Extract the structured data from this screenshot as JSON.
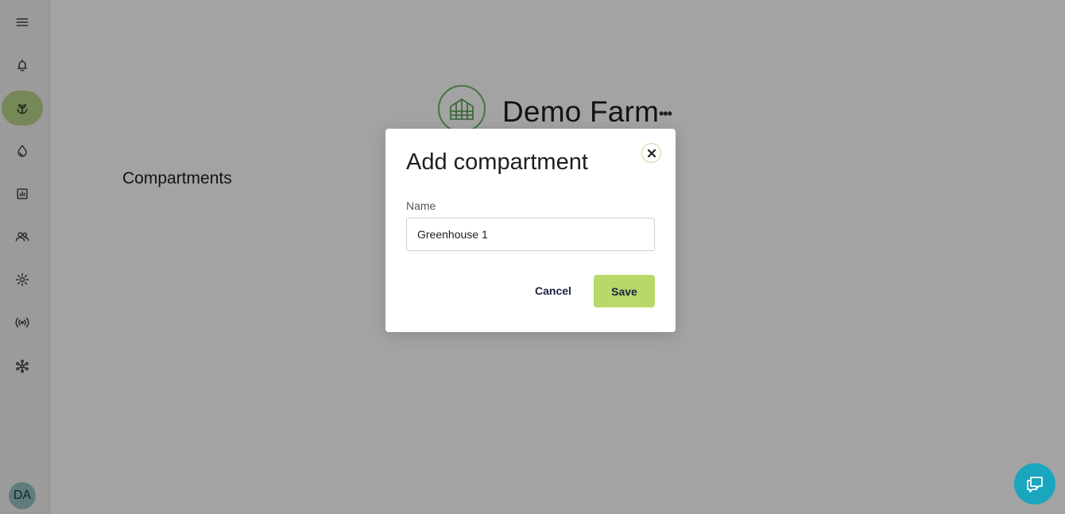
{
  "sidebar": {
    "items": [
      {
        "name": "menu",
        "icon": "menu-icon"
      },
      {
        "name": "notifications",
        "icon": "bell-icon"
      },
      {
        "name": "farm",
        "icon": "plant-icon",
        "active": true
      },
      {
        "name": "water",
        "icon": "water-drop-icon"
      },
      {
        "name": "reports",
        "icon": "bar-chart-icon"
      },
      {
        "name": "users",
        "icon": "people-icon"
      },
      {
        "name": "settings",
        "icon": "gear-icon"
      },
      {
        "name": "sensors",
        "icon": "broadcast-icon"
      },
      {
        "name": "network",
        "icon": "network-icon"
      }
    ],
    "avatar_initials": "DA"
  },
  "header": {
    "farm_name": "Demo Farm",
    "more_label": "•••",
    "logo_icon": "greenhouse-icon"
  },
  "main": {
    "section_title": "Compartments"
  },
  "modal": {
    "title": "Add compartment",
    "name_label": "Name",
    "name_value": "Greenhouse 1",
    "cancel_label": "Cancel",
    "save_label": "Save"
  },
  "colors": {
    "accent": "#b9d86a",
    "active_nav": "#b9d58a",
    "chat_button": "#1aa6bf",
    "logo_ring": "#6fb66b"
  }
}
